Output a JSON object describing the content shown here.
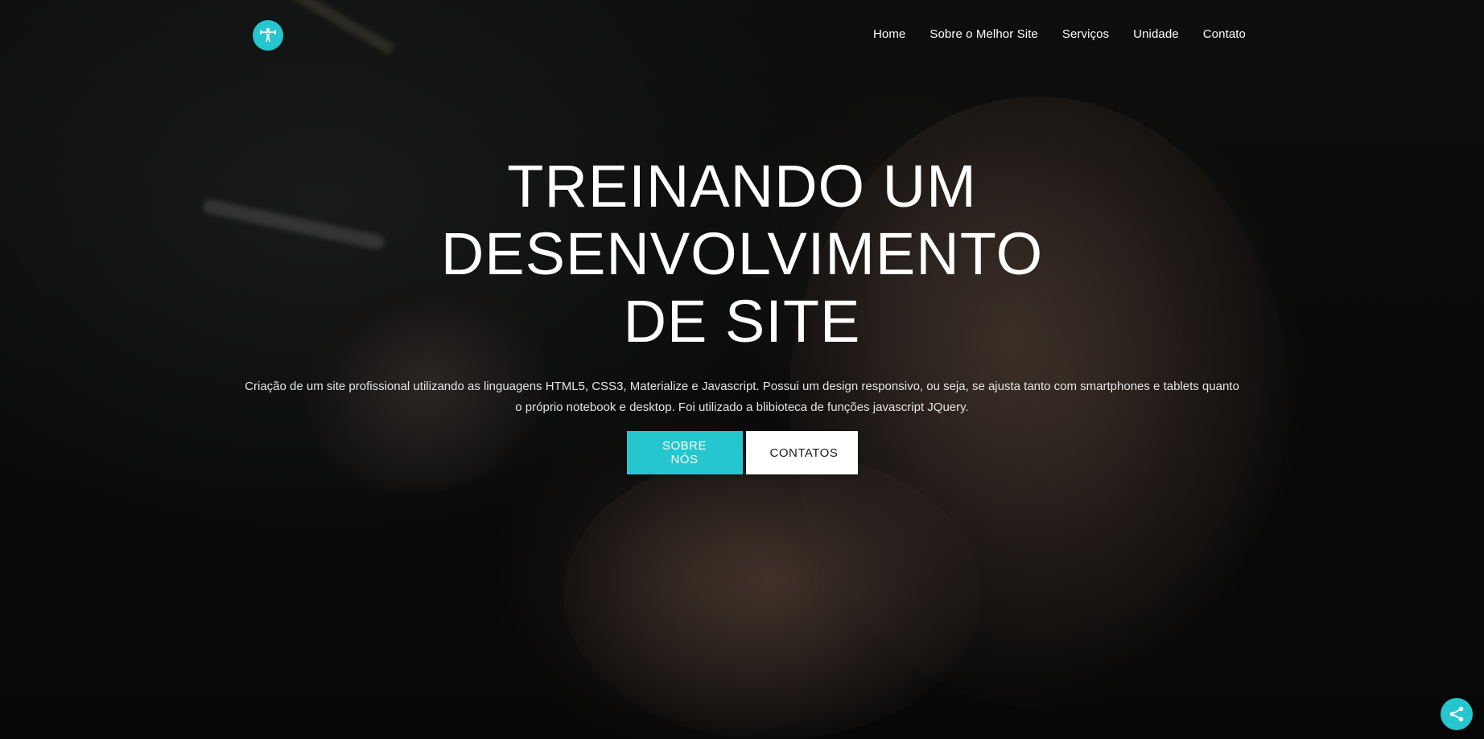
{
  "brand": {
    "logo_icon": "weightlifter-icon",
    "accent_color": "#26c6ce"
  },
  "nav": {
    "items": [
      {
        "label": "Home"
      },
      {
        "label": "Sobre o Melhor Site"
      },
      {
        "label": "Serviços"
      },
      {
        "label": "Unidade"
      },
      {
        "label": "Contato"
      }
    ]
  },
  "hero": {
    "title_line1": "TREINANDO UM DESENVOLVIMENTO",
    "title_line2": "DE SITE",
    "description": "Criação de um site profissional utilizando as linguagens HTML5, CSS3, Materialize e Javascript. Possui um design responsivo, ou seja, se ajusta tanto com smartphones e tablets quanto o próprio notebook e desktop. Foi utilizado a blibioteca de funções javascript JQuery.",
    "primary_button": "SOBRE NÓS",
    "secondary_button": "CONTATOS"
  },
  "fab": {
    "icon": "share-icon"
  }
}
